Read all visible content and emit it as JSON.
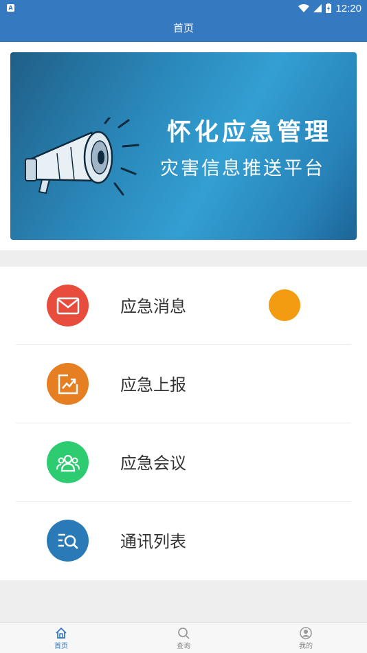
{
  "status_bar": {
    "time": "12:20",
    "app_icon_letter": "A"
  },
  "header": {
    "title": "首页"
  },
  "banner": {
    "title": "怀化应急管理",
    "subtitle": "灾害信息推送平台"
  },
  "menu": {
    "items": [
      {
        "label": "应急消息",
        "icon": "mail-icon",
        "color": "#e74c3c"
      },
      {
        "label": "应急上报",
        "icon": "report-chart-icon",
        "color": "#e67e22"
      },
      {
        "label": "应急会议",
        "icon": "meeting-people-icon",
        "color": "#2ecc71"
      },
      {
        "label": "通讯列表",
        "icon": "search-list-icon",
        "color": "#2a7ab8"
      }
    ],
    "badge_color": "#f39c12"
  },
  "tabbar": {
    "tabs": [
      {
        "label": "首页",
        "icon": "home-icon",
        "active": true
      },
      {
        "label": "查询",
        "icon": "search-icon",
        "active": false
      },
      {
        "label": "我的",
        "icon": "profile-icon",
        "active": false
      }
    ]
  },
  "colors": {
    "primary": "#3579c0",
    "background": "#eeeeee"
  }
}
